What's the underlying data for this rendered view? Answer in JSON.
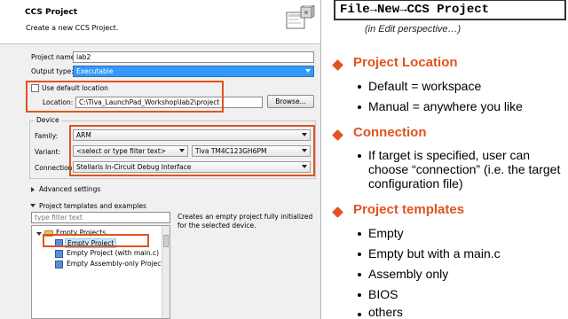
{
  "dialog": {
    "title": "CCS Project",
    "subtitle": "Create a new CCS Project.",
    "project_name_label": "Project name:",
    "project_name_value": "lab2",
    "output_type_label": "Output type:",
    "output_type_value": "Executable",
    "use_default_location_label": "Use default location",
    "use_default_location_checked": false,
    "location_label": "Location:",
    "location_value": "C:\\Tiva_LaunchPad_Workshop\\lab2\\project",
    "browse_button": "Browse...",
    "device_group": "Device",
    "family_label": "Family:",
    "family_value": "ARM",
    "variant_label": "Variant:",
    "variant_filter_placeholder": "<select or type filter text>",
    "variant_value": "Tiva TM4C123GH6PM",
    "connection_label": "Connection:",
    "connection_value": "Stellaris In-Circuit Debug Interface",
    "advanced_settings": "Advanced settings",
    "templates_section": "Project templates and examples",
    "template_filter_placeholder": "type filter text",
    "template_tree": {
      "folder": "Empty Projects",
      "items": [
        "Empty Project",
        "Empty Project (with main.c)",
        "Empty Assembly-only Project"
      ],
      "selected": "Empty Project"
    },
    "template_description": "Creates an empty project fully initialized for the selected device."
  },
  "slide": {
    "menu_path": "File→New→CCS Project",
    "note": "(in Edit perspective…)",
    "sections": [
      {
        "heading": "Project Location",
        "bullets": [
          "Default = workspace",
          "Manual = anywhere you like"
        ]
      },
      {
        "heading": "Connection",
        "bullets": [
          "If target is specified, user can choose “connection” (i.e. the target configuration file)"
        ]
      },
      {
        "heading": "Project templates",
        "bullets": [
          "Empty",
          "Empty but with a main.c",
          "Assembly only",
          "BIOS",
          "others"
        ]
      }
    ],
    "accent_color": "#e0531f"
  }
}
